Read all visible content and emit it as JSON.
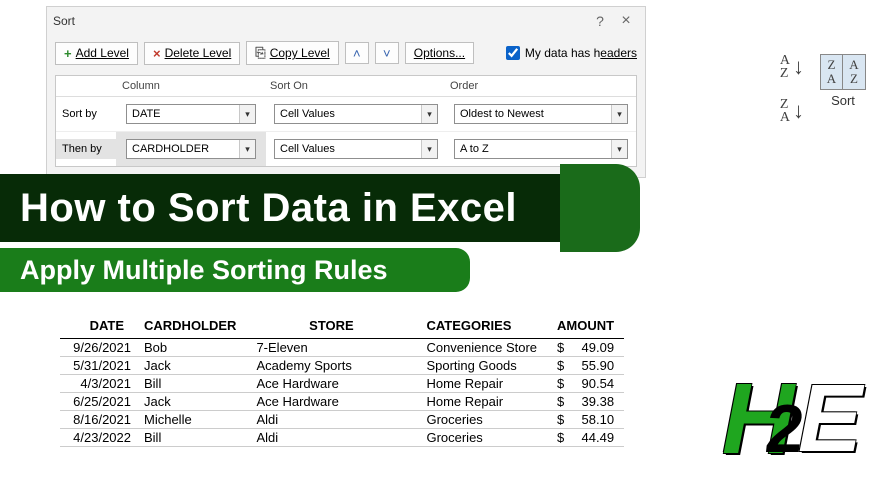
{
  "dialog": {
    "title": "Sort",
    "buttons": {
      "add": "Add Level",
      "delete": "Delete Level",
      "copy": "Copy Level",
      "options": "Options..."
    },
    "headers_checkbox_prefix": "My data has h",
    "headers_checkbox_suffix": "eaders",
    "columns": {
      "column": "Column",
      "sorton": "Sort On",
      "order": "Order"
    },
    "levels": [
      {
        "label": "Sort by",
        "field": "DATE",
        "sorton": "Cell Values",
        "order": "Oldest to Newest"
      },
      {
        "label": "Then by",
        "field": "CARDHOLDER",
        "sorton": "Cell Values",
        "order": "A to Z"
      }
    ]
  },
  "ribbon": {
    "sort_asc_top": "A",
    "sort_asc_bot": "Z",
    "sort_desc_top": "Z",
    "sort_desc_bot": "A",
    "big_label": "Sort"
  },
  "banner": {
    "line1": "How to Sort Data in Excel",
    "line2": "Apply Multiple Sorting Rules"
  },
  "table": {
    "headers": {
      "date": "DATE",
      "card": "CARDHOLDER",
      "store": "STORE",
      "cat": "CATEGORIES",
      "amt": "AMOUNT"
    },
    "rows": [
      {
        "date": "9/26/2021",
        "card": "Bob",
        "store": "7-Eleven",
        "cat": "Convenience Store",
        "amt": "49.09"
      },
      {
        "date": "5/31/2021",
        "card": "Jack",
        "store": "Academy Sports",
        "cat": "Sporting Goods",
        "amt": "55.90"
      },
      {
        "date": "4/3/2021",
        "card": "Bill",
        "store": "Ace Hardware",
        "cat": "Home Repair",
        "amt": "90.54"
      },
      {
        "date": "6/25/2021",
        "card": "Jack",
        "store": "Ace Hardware",
        "cat": "Home Repair",
        "amt": "39.38"
      },
      {
        "date": "8/16/2021",
        "card": "Michelle",
        "store": "Aldi",
        "cat": "Groceries",
        "amt": "58.10"
      },
      {
        "date": "4/23/2022",
        "card": "Bill",
        "store": "Aldi",
        "cat": "Groceries",
        "amt": "44.49"
      }
    ]
  },
  "currency": "$"
}
